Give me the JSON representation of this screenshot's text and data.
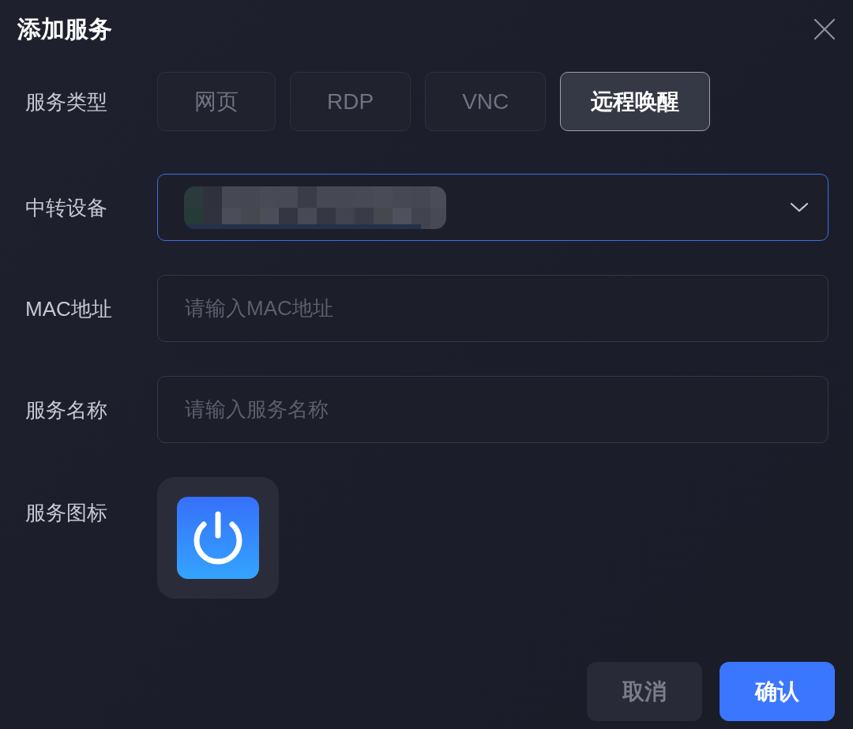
{
  "dialog": {
    "title": "添加服务"
  },
  "fields": [
    {
      "kind": "segmented",
      "label": "服务类型",
      "options": [
        {
          "label": "网页",
          "selected": false
        },
        {
          "label": "RDP",
          "selected": false
        },
        {
          "label": "VNC",
          "selected": false
        },
        {
          "label": "远程唤醒",
          "selected": true
        }
      ]
    },
    {
      "kind": "select",
      "label": "中转设备",
      "focused": true,
      "value_redacted": true
    },
    {
      "kind": "input",
      "label": "MAC地址",
      "placeholder": "请输入MAC地址"
    },
    {
      "kind": "input",
      "label": "服务名称",
      "placeholder": "请输入服务名称"
    },
    {
      "kind": "icon_picker",
      "label": "服务图标"
    }
  ],
  "buttons": [
    {
      "label": "取消",
      "kind": "secondary"
    },
    {
      "label": "确认",
      "kind": "primary"
    }
  ]
}
